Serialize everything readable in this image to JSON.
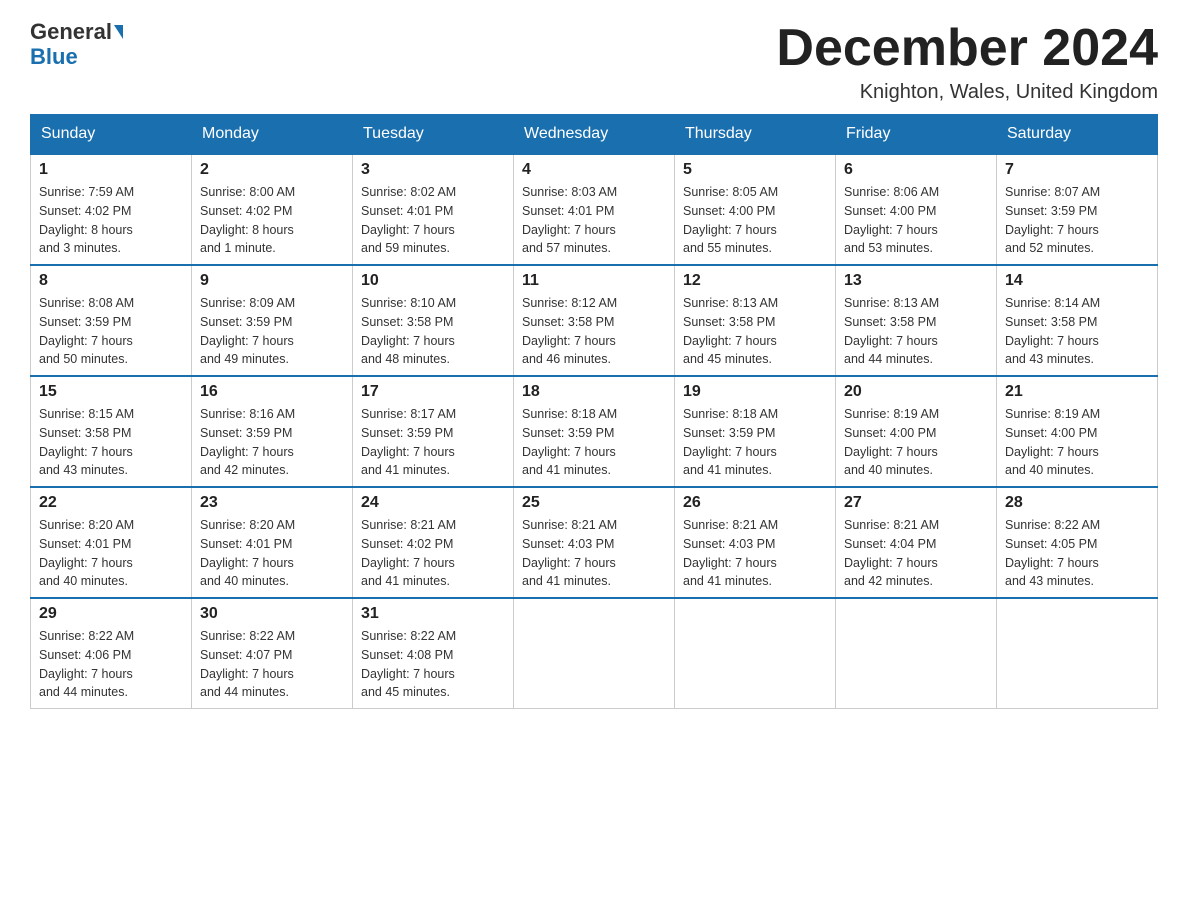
{
  "header": {
    "logo_general": "General",
    "logo_blue": "Blue",
    "month_title": "December 2024",
    "location": "Knighton, Wales, United Kingdom"
  },
  "days_of_week": [
    "Sunday",
    "Monday",
    "Tuesday",
    "Wednesday",
    "Thursday",
    "Friday",
    "Saturday"
  ],
  "weeks": [
    [
      {
        "day": "1",
        "sunrise": "7:59 AM",
        "sunset": "4:02 PM",
        "daylight": "8 hours and 3 minutes."
      },
      {
        "day": "2",
        "sunrise": "8:00 AM",
        "sunset": "4:02 PM",
        "daylight": "8 hours and 1 minute."
      },
      {
        "day": "3",
        "sunrise": "8:02 AM",
        "sunset": "4:01 PM",
        "daylight": "7 hours and 59 minutes."
      },
      {
        "day": "4",
        "sunrise": "8:03 AM",
        "sunset": "4:01 PM",
        "daylight": "7 hours and 57 minutes."
      },
      {
        "day": "5",
        "sunrise": "8:05 AM",
        "sunset": "4:00 PM",
        "daylight": "7 hours and 55 minutes."
      },
      {
        "day": "6",
        "sunrise": "8:06 AM",
        "sunset": "4:00 PM",
        "daylight": "7 hours and 53 minutes."
      },
      {
        "day": "7",
        "sunrise": "8:07 AM",
        "sunset": "3:59 PM",
        "daylight": "7 hours and 52 minutes."
      }
    ],
    [
      {
        "day": "8",
        "sunrise": "8:08 AM",
        "sunset": "3:59 PM",
        "daylight": "7 hours and 50 minutes."
      },
      {
        "day": "9",
        "sunrise": "8:09 AM",
        "sunset": "3:59 PM",
        "daylight": "7 hours and 49 minutes."
      },
      {
        "day": "10",
        "sunrise": "8:10 AM",
        "sunset": "3:58 PM",
        "daylight": "7 hours and 48 minutes."
      },
      {
        "day": "11",
        "sunrise": "8:12 AM",
        "sunset": "3:58 PM",
        "daylight": "7 hours and 46 minutes."
      },
      {
        "day": "12",
        "sunrise": "8:13 AM",
        "sunset": "3:58 PM",
        "daylight": "7 hours and 45 minutes."
      },
      {
        "day": "13",
        "sunrise": "8:13 AM",
        "sunset": "3:58 PM",
        "daylight": "7 hours and 44 minutes."
      },
      {
        "day": "14",
        "sunrise": "8:14 AM",
        "sunset": "3:58 PM",
        "daylight": "7 hours and 43 minutes."
      }
    ],
    [
      {
        "day": "15",
        "sunrise": "8:15 AM",
        "sunset": "3:58 PM",
        "daylight": "7 hours and 43 minutes."
      },
      {
        "day": "16",
        "sunrise": "8:16 AM",
        "sunset": "3:59 PM",
        "daylight": "7 hours and 42 minutes."
      },
      {
        "day": "17",
        "sunrise": "8:17 AM",
        "sunset": "3:59 PM",
        "daylight": "7 hours and 41 minutes."
      },
      {
        "day": "18",
        "sunrise": "8:18 AM",
        "sunset": "3:59 PM",
        "daylight": "7 hours and 41 minutes."
      },
      {
        "day": "19",
        "sunrise": "8:18 AM",
        "sunset": "3:59 PM",
        "daylight": "7 hours and 41 minutes."
      },
      {
        "day": "20",
        "sunrise": "8:19 AM",
        "sunset": "4:00 PM",
        "daylight": "7 hours and 40 minutes."
      },
      {
        "day": "21",
        "sunrise": "8:19 AM",
        "sunset": "4:00 PM",
        "daylight": "7 hours and 40 minutes."
      }
    ],
    [
      {
        "day": "22",
        "sunrise": "8:20 AM",
        "sunset": "4:01 PM",
        "daylight": "7 hours and 40 minutes."
      },
      {
        "day": "23",
        "sunrise": "8:20 AM",
        "sunset": "4:01 PM",
        "daylight": "7 hours and 40 minutes."
      },
      {
        "day": "24",
        "sunrise": "8:21 AM",
        "sunset": "4:02 PM",
        "daylight": "7 hours and 41 minutes."
      },
      {
        "day": "25",
        "sunrise": "8:21 AM",
        "sunset": "4:03 PM",
        "daylight": "7 hours and 41 minutes."
      },
      {
        "day": "26",
        "sunrise": "8:21 AM",
        "sunset": "4:03 PM",
        "daylight": "7 hours and 41 minutes."
      },
      {
        "day": "27",
        "sunrise": "8:21 AM",
        "sunset": "4:04 PM",
        "daylight": "7 hours and 42 minutes."
      },
      {
        "day": "28",
        "sunrise": "8:22 AM",
        "sunset": "4:05 PM",
        "daylight": "7 hours and 43 minutes."
      }
    ],
    [
      {
        "day": "29",
        "sunrise": "8:22 AM",
        "sunset": "4:06 PM",
        "daylight": "7 hours and 44 minutes."
      },
      {
        "day": "30",
        "sunrise": "8:22 AM",
        "sunset": "4:07 PM",
        "daylight": "7 hours and 44 minutes."
      },
      {
        "day": "31",
        "sunrise": "8:22 AM",
        "sunset": "4:08 PM",
        "daylight": "7 hours and 45 minutes."
      },
      null,
      null,
      null,
      null
    ]
  ],
  "labels": {
    "sunrise": "Sunrise:",
    "sunset": "Sunset:",
    "daylight": "Daylight:"
  }
}
